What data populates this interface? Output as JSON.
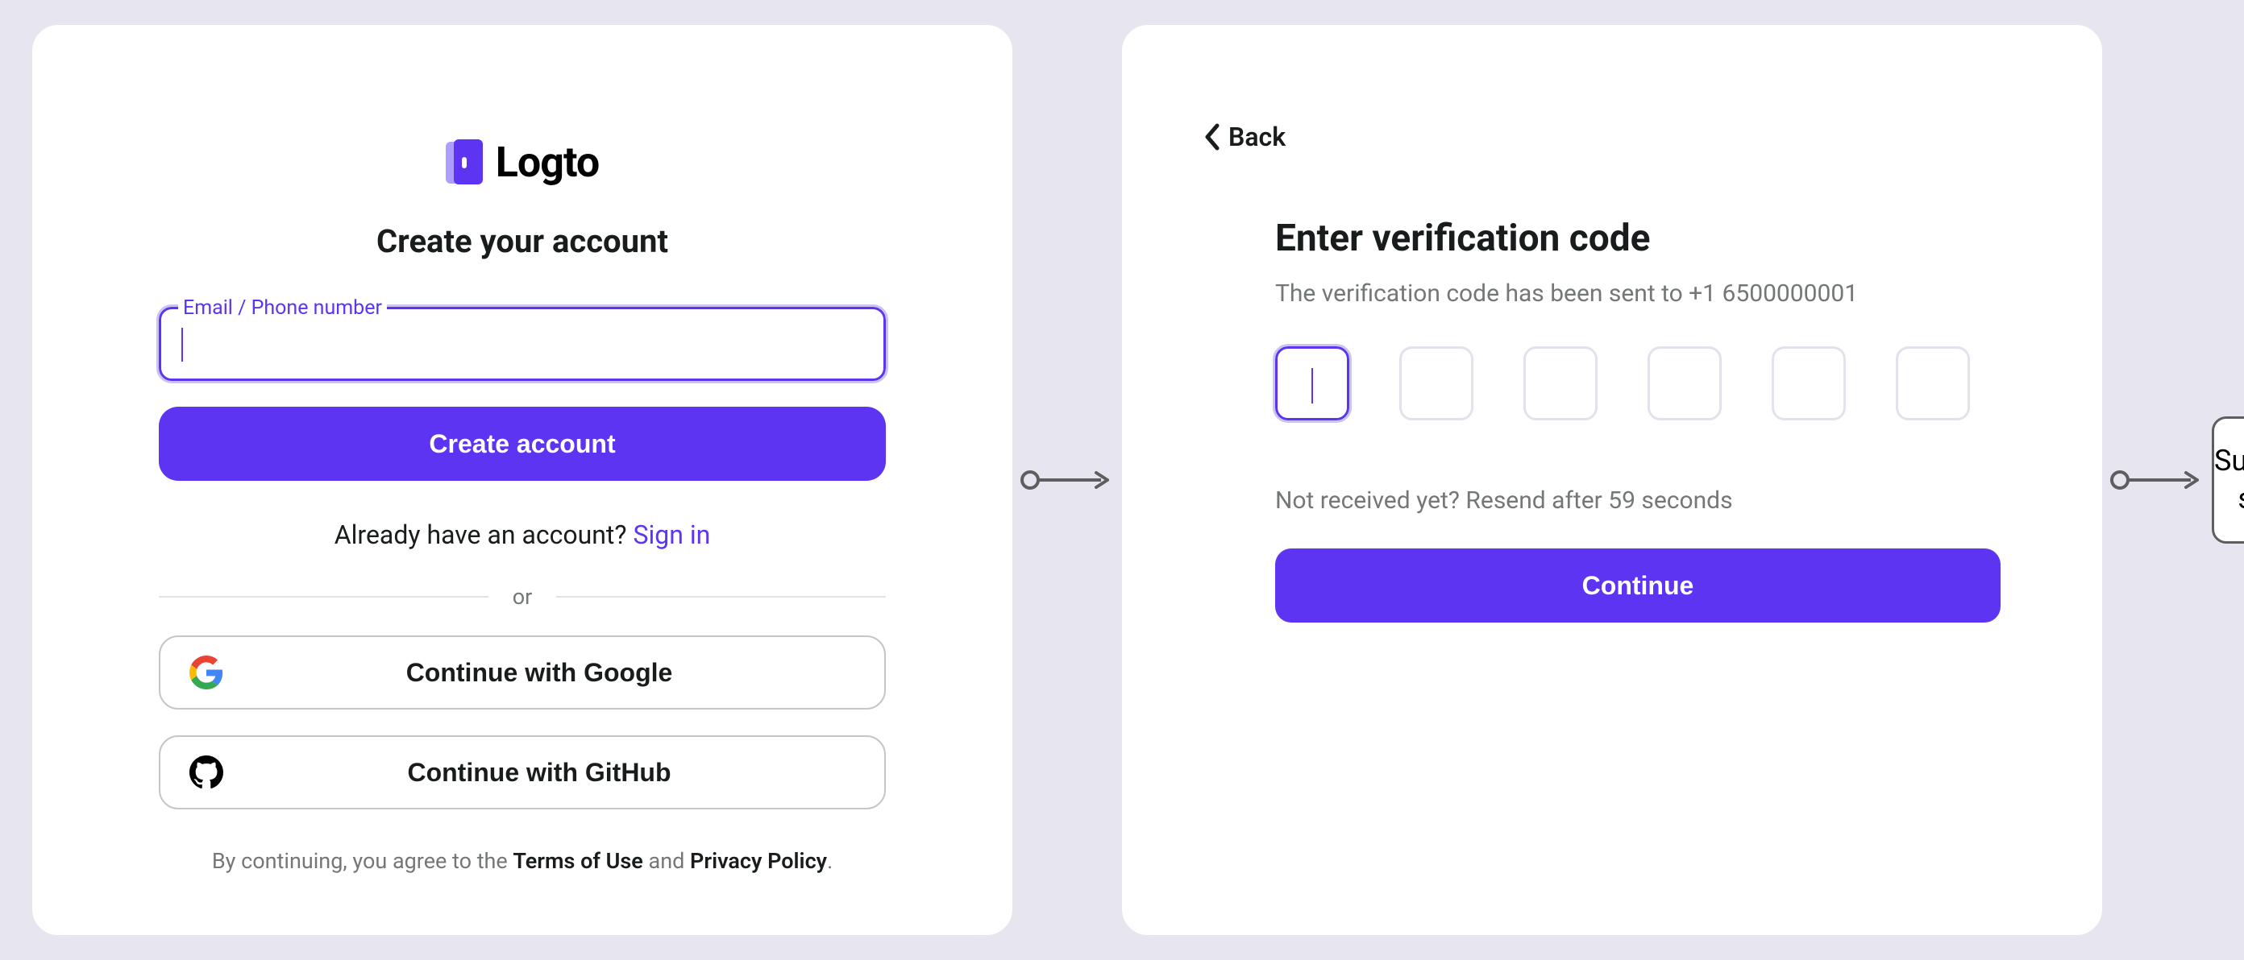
{
  "colors": {
    "accent": "#5D34F2",
    "background": "#E7E5F0"
  },
  "signup": {
    "brand": "Logto",
    "title": "Create your account",
    "field_label": "Email / Phone number",
    "field_value": "",
    "submit_label": "Create account",
    "signin_prompt": "Already have an account? ",
    "signin_link": "Sign in",
    "divider": "or",
    "social": {
      "google": "Continue with Google",
      "github": "Continue with GitHub"
    },
    "legal_prefix": "By continuing, you agree to the ",
    "legal_terms": "Terms of Use",
    "legal_mid": " and ",
    "legal_privacy": "Privacy Policy",
    "legal_suffix": "."
  },
  "verify": {
    "back_label": "Back",
    "title": "Enter verification code",
    "subtitle": "The verification code has been sent to +1 6500000001",
    "code_length": 6,
    "resend_text": "Not received yet? Resend after 59 seconds",
    "continue_label": "Continue"
  },
  "end": {
    "label": "Successful sign-up"
  }
}
